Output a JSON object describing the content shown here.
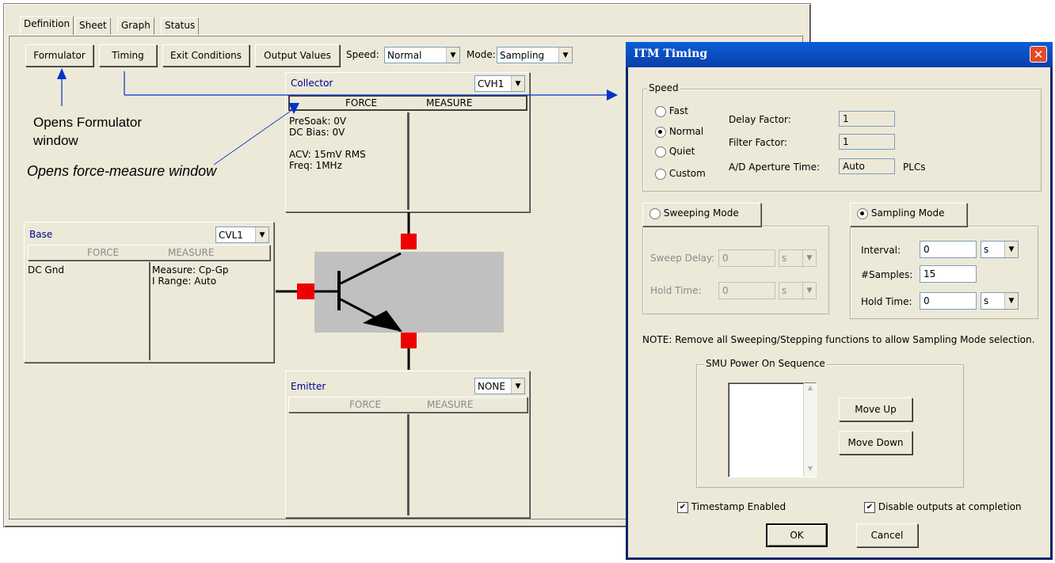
{
  "main": {
    "tabs": [
      "Definition",
      "Sheet",
      "Graph",
      "Status"
    ],
    "toolbar": {
      "formulator": "Formulator",
      "timing": "Timing",
      "exit_conditions": "Exit Conditions",
      "output_values": "Output Values",
      "speed_label": "Speed:",
      "speed_value": "Normal",
      "mode_label": "Mode:",
      "mode_value": "Sampling"
    },
    "collector": {
      "title": "Collector",
      "instrument": "CVH1",
      "force": "FORCE",
      "measure": "MEASURE",
      "lines": [
        "PreSoak: 0V",
        "DC Bias: 0V",
        "",
        "ACV: 15mV RMS",
        "Freq: 1MHz"
      ]
    },
    "base": {
      "title": "Base",
      "instrument": "CVL1",
      "force": "FORCE",
      "measure": "MEASURE",
      "force_text": "DC Gnd",
      "measure_lines": [
        "Measure: Cp-Gp",
        "I Range: Auto"
      ]
    },
    "emitter": {
      "title": "Emitter",
      "instrument": "NONE",
      "force": "FORCE",
      "measure": "MEASURE"
    }
  },
  "annotations": {
    "formulator": "Opens Formulator window",
    "force_measure": "Opens force-measure window"
  },
  "dialog": {
    "title": "ITM Timing",
    "speed_group": "Speed",
    "speed_options": [
      "Fast",
      "Normal",
      "Quiet",
      "Custom"
    ],
    "speed_selected": "Normal",
    "delay_factor_label": "Delay Factor:",
    "delay_factor": "1",
    "filter_factor_label": "Filter Factor:",
    "filter_factor": "1",
    "aperture_label": "A/D Aperture Time:",
    "aperture": "Auto",
    "aperture_unit": "PLCs",
    "sweeping_mode": "Sweeping Mode",
    "sweep_delay_label": "Sweep Delay:",
    "sweep_delay": "0",
    "sweep_delay_unit": "s",
    "sweep_hold_label": "Hold Time:",
    "sweep_hold": "0",
    "sweep_hold_unit": "s",
    "sampling_mode": "Sampling Mode",
    "interval_label": "Interval:",
    "interval": "0",
    "interval_unit": "s",
    "samples_label": "#Samples:",
    "samples": "15",
    "hold_label": "Hold Time:",
    "hold": "0",
    "hold_unit": "s",
    "note": "NOTE: Remove all Sweeping/Stepping functions to allow Sampling Mode selection.",
    "smu_group": "SMU Power On Sequence",
    "move_up": "Move Up",
    "move_down": "Move Down",
    "timestamp": "Timestamp Enabled",
    "disable_outputs": "Disable outputs at completion",
    "ok": "OK",
    "cancel": "Cancel"
  },
  "colors": {
    "title_bar": "#0a246a",
    "arrow": "#0033cc",
    "terminal": "#ee0000",
    "transistor_bg": "#c0c0c0"
  }
}
